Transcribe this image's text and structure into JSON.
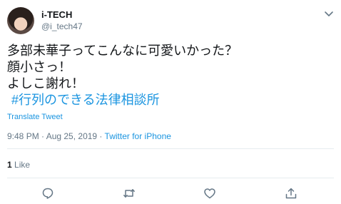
{
  "tweet": {
    "user": {
      "name": "i-TECH",
      "handle": "@i_tech47"
    },
    "text": {
      "line1": "多部未華子ってこんなに可愛いかった？",
      "line2": "顔小さっ！",
      "line3": "よしこ謝れ！",
      "hashtag": "#行列のできる法律相談所"
    },
    "translate_label": "Translate Tweet",
    "meta": {
      "timestamp": "9:48 PM · Aug 25, 2019 · ",
      "source": "Twitter for iPhone"
    },
    "likes": {
      "count": "1",
      "label": " Like"
    }
  },
  "icons": {
    "more": "chevron-down-icon",
    "reply": "reply-icon",
    "retweet": "retweet-icon",
    "like": "heart-icon",
    "share": "share-icon"
  },
  "colors": {
    "link": "#1b95e0",
    "secondary": "#657786",
    "text": "#14171a",
    "divider": "#e6ecf0"
  }
}
